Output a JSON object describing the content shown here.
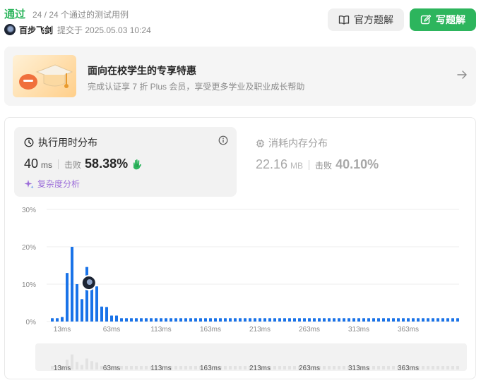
{
  "header": {
    "status": "通过",
    "test_summary": "24 / 24 个通过的测试用例",
    "user_name": "百步飞剑",
    "submit_time": "提交于 2025.05.03 10:24",
    "official_solution_label": "官方题解",
    "write_solution_label": "写题解"
  },
  "promo": {
    "title": "面向在校学生的专享特惠",
    "subtitle": "完成认证享 7 折 Plus 会员，享受更多学业及职业成长帮助"
  },
  "runtime": {
    "title": "执行用时分布",
    "value": "40",
    "unit": "ms",
    "beats_label": "击败",
    "beats_value": "58.38%",
    "complexity_label": "复杂度分析"
  },
  "memory": {
    "title": "消耗内存分布",
    "value": "22.16",
    "unit": "MB",
    "beats_label": "击败",
    "beats_value": "40.10%"
  },
  "colors": {
    "accent_green": "#2db55d",
    "bar_blue": "#1a73e8",
    "bar_blue_light": "#8cc5ff"
  },
  "chart_data": {
    "type": "bar",
    "ylabel": "",
    "xlabel": "",
    "y_ticks": [
      "30%",
      "20%",
      "10%",
      "0%"
    ],
    "ylim": [
      0,
      30
    ],
    "x_ticks": [
      "13ms",
      "63ms",
      "113ms",
      "163ms",
      "213ms",
      "263ms",
      "313ms",
      "363ms"
    ],
    "x_start_ms": 3,
    "x_step_ms": 5,
    "values": [
      0.9,
      0.9,
      1.2,
      13,
      20,
      10,
      6,
      14.6,
      11,
      9.4,
      4,
      3.9,
      1.6,
      1.6,
      0.9,
      0.9,
      0.9,
      0.9,
      0.9,
      0.9,
      0.9,
      0.9,
      0.9,
      0.9,
      0.9,
      0.9,
      0.9,
      0.9,
      0.9,
      0.9,
      0.9,
      0.9,
      0.9,
      0.9,
      0.9,
      0.9,
      0.9,
      0.9,
      0.9,
      0.9,
      0.9,
      0.9,
      0.9,
      0.9,
      0.9,
      0.9,
      0.9,
      0.9,
      0.9,
      0.9,
      0.9,
      0.9,
      0.9,
      0.9,
      0.9,
      0.9,
      0.9,
      0.9,
      0.9,
      0.9,
      0.9,
      0.9,
      0.9,
      0.9,
      0.9,
      0.9,
      0.9,
      0.9,
      0.9,
      0.9,
      0.9,
      0.9,
      0.9,
      0.9,
      0.9,
      0.9,
      0.9,
      0.9,
      0.9,
      0.9,
      0.9,
      0.9,
      0.9
    ],
    "marker_ms": 40,
    "grid": true,
    "legend": "none"
  }
}
